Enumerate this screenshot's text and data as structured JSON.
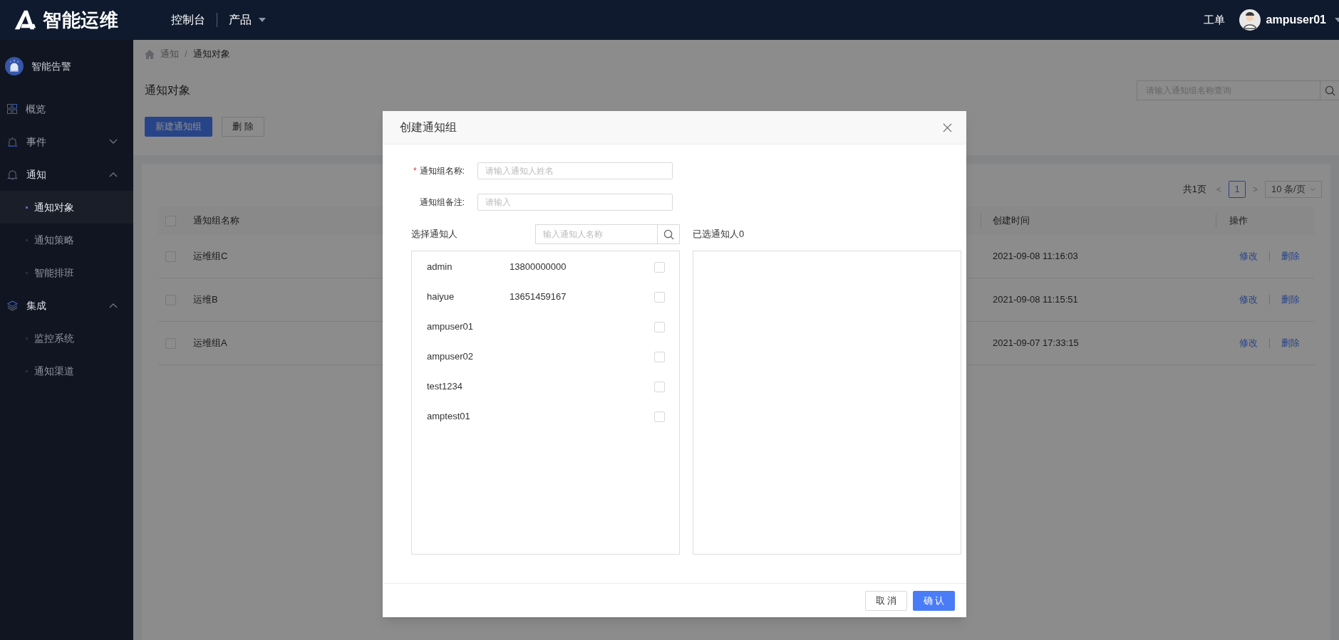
{
  "top_bar": {
    "logo_text": "智能运维",
    "nav": [
      {
        "label": "控制台",
        "has_dropdown": false
      },
      {
        "label": "产品",
        "has_dropdown": true
      }
    ],
    "work_order": "工单",
    "user": "ampuser01"
  },
  "sidebar": {
    "app_title": "智能告警",
    "items": [
      {
        "label": "概览",
        "kind": "link"
      },
      {
        "label": "事件",
        "kind": "group",
        "expanded": false
      },
      {
        "label": "通知",
        "kind": "group",
        "expanded": true,
        "children": [
          {
            "label": "通知对象",
            "selected": true
          },
          {
            "label": "通知策略",
            "selected": false
          },
          {
            "label": "智能排班",
            "selected": false
          }
        ]
      },
      {
        "label": "集成",
        "kind": "group",
        "expanded": true,
        "children": [
          {
            "label": "监控系统",
            "selected": false
          },
          {
            "label": "通知渠道",
            "selected": false
          }
        ]
      }
    ]
  },
  "page": {
    "breadcrumb": [
      "通知",
      "通知对象"
    ],
    "breadcrumb_separator": "/",
    "title": "通知对象",
    "buttons": [
      {
        "label": "新建通知组",
        "kind": "primary"
      },
      {
        "label": "删 除",
        "kind": "default"
      }
    ],
    "search_placeholder": "请输入通知组名称查询",
    "pagination": {
      "total": "共1页",
      "current_page": "1",
      "page_size": "10 条/页"
    },
    "table": {
      "columns": [
        "通知组名称",
        "创建时间",
        "操作"
      ],
      "header_checked": false,
      "rows": [
        {
          "checked": false,
          "name": "运维组C",
          "created": "2021-09-08 11:16:03",
          "actions": [
            "修改",
            "删除"
          ]
        },
        {
          "checked": false,
          "name": "运维B",
          "created": "2021-09-08 11:15:51",
          "actions": [
            "修改",
            "删除"
          ]
        },
        {
          "checked": false,
          "name": "运维组A",
          "created": "2021-09-07 17:33:15",
          "actions": [
            "修改",
            "删除"
          ]
        }
      ]
    }
  },
  "modal": {
    "title": "创建通知组",
    "required_mark": "*",
    "fields": [
      {
        "label": "通知组名称:",
        "required": true,
        "placeholder": "请输入通知人姓名"
      },
      {
        "label": "通知组备注:",
        "required": false,
        "placeholder": "请输入"
      }
    ],
    "select_label": "选择通知人",
    "search_placeholder": "输入通知人名称",
    "selected_label": "已选通知人0",
    "people": [
      {
        "name": "admin",
        "phone": "13800000000",
        "checked": false
      },
      {
        "name": "haiyue",
        "phone": "13651459167",
        "checked": false
      },
      {
        "name": "ampuser01",
        "checked": false
      },
      {
        "name": "ampuser02",
        "checked": false
      },
      {
        "name": "test1234",
        "checked": false
      },
      {
        "name": "amptest01",
        "checked": false
      }
    ],
    "buttons": [
      {
        "label": "取 消",
        "kind": "default"
      },
      {
        "label": "确 认",
        "kind": "primary"
      }
    ]
  }
}
